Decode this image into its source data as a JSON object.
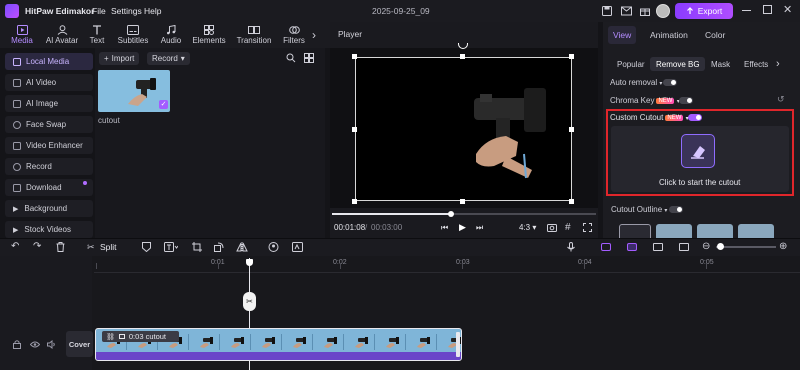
{
  "app": {
    "name": "HitPaw Edimakor",
    "menus": [
      "File",
      "Settings",
      "Help"
    ],
    "project_title": "2025-09-25_09",
    "export_label": "Export"
  },
  "toolbar": {
    "items": [
      "Media",
      "AI Avatar",
      "Text",
      "Subtitles",
      "Audio",
      "Elements",
      "Transition",
      "Filters"
    ],
    "active": "Media"
  },
  "sidebar": {
    "items": [
      "Local Media",
      "AI Video",
      "AI Image",
      "Face Swap",
      "Video Enhancer",
      "Record",
      "Download",
      "Background",
      "Stock Videos"
    ],
    "active": "Local Media"
  },
  "media": {
    "import_label": "Import",
    "record_label": "Record",
    "clip_name": "cutout"
  },
  "player": {
    "title": "Player",
    "current_time": "00:01:08",
    "total_time": "00:03:00",
    "aspect": "4:3",
    "progress": 0.45
  },
  "right_panel": {
    "tabs": [
      "View",
      "Animation",
      "Color"
    ],
    "active_tab": "View",
    "subtabs": [
      "Popular",
      "Remove BG",
      "Mask",
      "Effects"
    ],
    "active_subtab": "Remove BG",
    "auto_removal": "Auto removal",
    "chroma_key": "Chroma Key",
    "custom_cutout": "Custom Cutout",
    "new_badge": "NEW",
    "cutout_prompt": "Click to start the cutout",
    "cutout_outline": "Cutout Outline"
  },
  "timeline": {
    "split_label": "Split",
    "ticks": [
      "0:01",
      "0:02",
      "0:03",
      "0:04",
      "0:05"
    ],
    "cover_label": "Cover",
    "clip_label": "0:03  cutout"
  },
  "colors": {
    "accent": "#a35cff",
    "highlight_border": "#e0262b",
    "clip_audio": "#6a46c9"
  }
}
